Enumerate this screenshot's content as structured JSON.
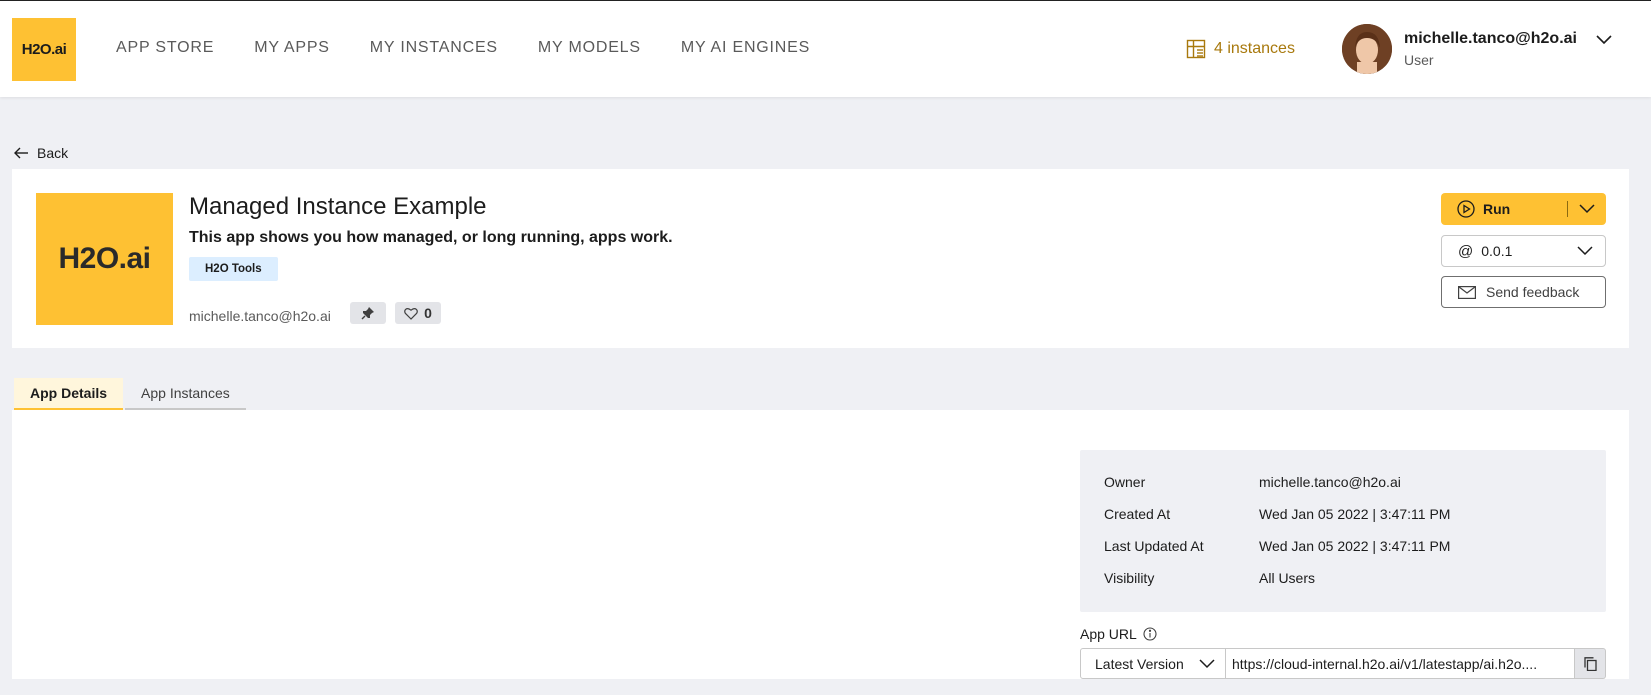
{
  "header": {
    "logo_text": "H2O.ai",
    "nav": [
      "APP STORE",
      "MY APPS",
      "MY INSTANCES",
      "MY MODELS",
      "MY AI ENGINES"
    ],
    "instances_label": "4 instances",
    "user": {
      "email": "michelle.tanco@h2o.ai",
      "role": "User"
    }
  },
  "back_label": "Back",
  "app": {
    "logo_text": "H2O.ai",
    "title": "Managed Instance Example",
    "description": "This app shows you how managed, or long running, apps work.",
    "tag": "H2O Tools",
    "owner": "michelle.tanco@h2o.ai",
    "likes": "0",
    "run_label": "Run",
    "version_prefix": "@",
    "version": "0.0.1",
    "feedback_label": "Send feedback"
  },
  "tabs": [
    "App Details",
    "App Instances"
  ],
  "details": {
    "rows": [
      {
        "key": "Owner",
        "value": "michelle.tanco@h2o.ai"
      },
      {
        "key": "Created At",
        "value": "Wed Jan 05 2022 | 3:47:11 PM"
      },
      {
        "key": "Last Updated At",
        "value": "Wed Jan 05 2022 | 3:47:11 PM"
      },
      {
        "key": "Visibility",
        "value": "All Users"
      }
    ],
    "url_label": "App URL",
    "url_version": "Latest Version",
    "url_value": "https://cloud-internal.h2o.ai/v1/latestapp/ai.h2o...."
  },
  "colors": {
    "brand": "#fec133",
    "instances": "#a8790d",
    "tag_bg": "#dceeff"
  },
  "icons": [
    "instances-grid-icon",
    "chevron-down-icon",
    "arrow-left-icon",
    "pin-icon",
    "heart-icon",
    "play-circle-icon",
    "mail-icon",
    "info-icon",
    "copy-icon"
  ]
}
